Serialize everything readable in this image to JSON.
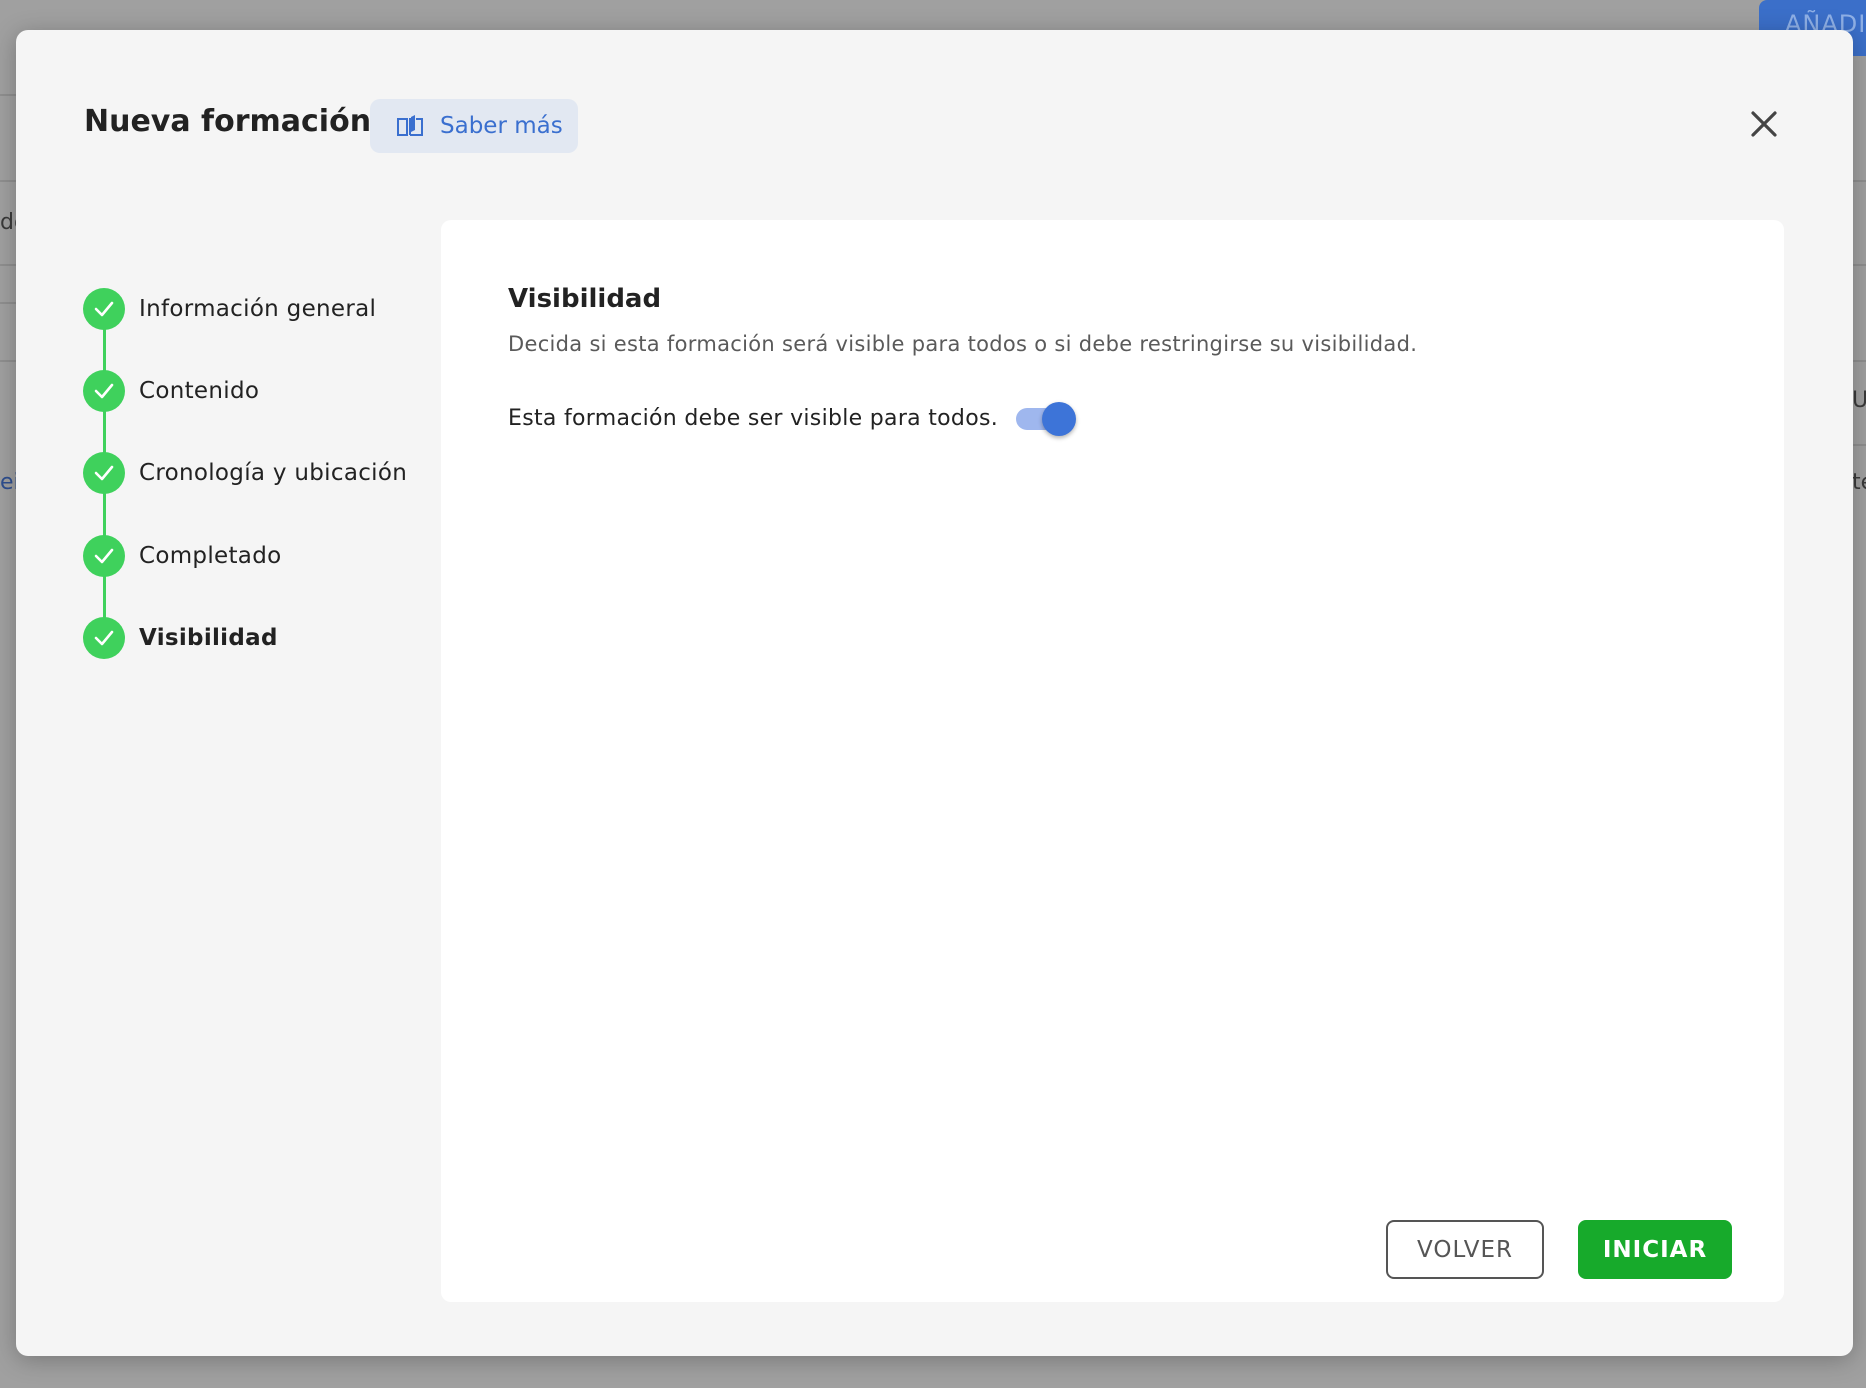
{
  "background": {
    "add_button_label": "AÑADI",
    "fragments": [
      "do",
      "eit",
      "U",
      "te"
    ]
  },
  "modal": {
    "title": "Nueva formación",
    "learn_more_label": "Saber más",
    "close_icon": "close-icon"
  },
  "stepper": {
    "steps": [
      {
        "label": "Información general",
        "status": "completed"
      },
      {
        "label": "Contenido",
        "status": "completed"
      },
      {
        "label": "Cronología y ubicación",
        "status": "completed"
      },
      {
        "label": "Completado",
        "status": "completed"
      },
      {
        "label": "Visibilidad",
        "status": "completed",
        "active": true
      }
    ]
  },
  "content": {
    "title": "Visibilidad",
    "description": "Decida si esta formación será visible para todos o si debe restringirse su visibilidad.",
    "toggle_label": "Esta formación debe ser visible para todos.",
    "toggle_on": true
  },
  "actions": {
    "back_label": "VOLVER",
    "start_label": "INICIAR"
  },
  "colors": {
    "accent": "#3d74d8",
    "success": "#3fd15c",
    "primary_button": "#17aa2b"
  }
}
